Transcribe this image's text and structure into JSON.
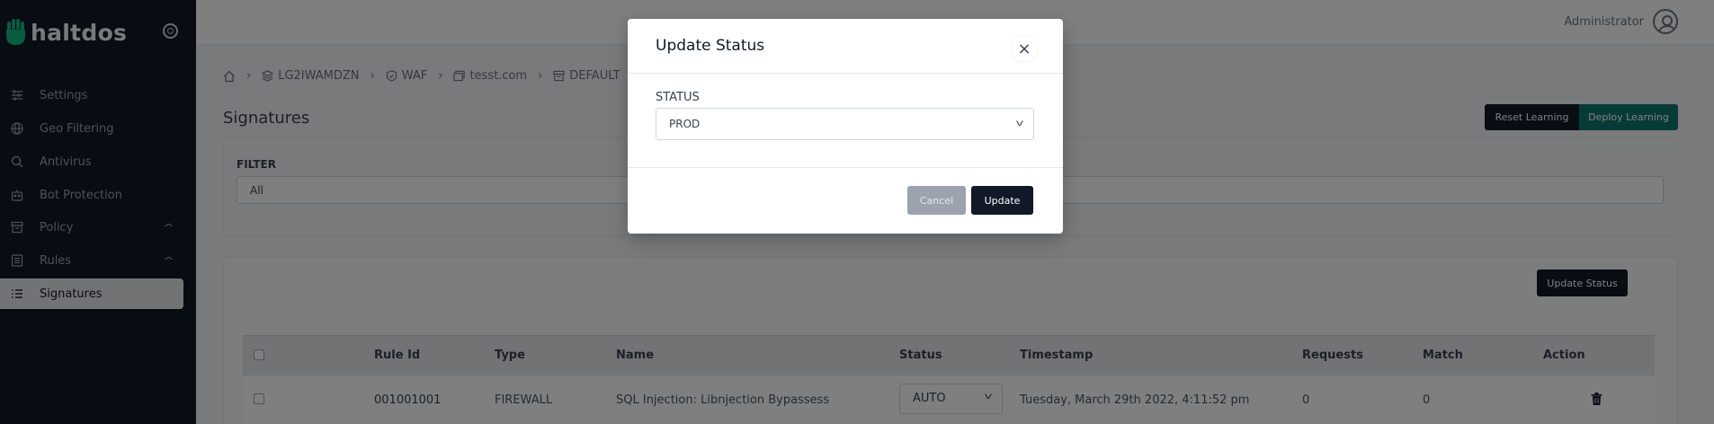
{
  "brand": {
    "name": "haltdos"
  },
  "sidebar": {
    "items": [
      {
        "label": "Settings",
        "icon": "sliders-icon"
      },
      {
        "label": "Geo Filtering",
        "icon": "globe-icon"
      },
      {
        "label": "Antivirus",
        "icon": "search-icon"
      },
      {
        "label": "Bot Protection",
        "icon": "robot-icon"
      },
      {
        "label": "Policy",
        "icon": "archive-icon"
      },
      {
        "label": "Rules",
        "icon": "document-icon"
      },
      {
        "label": "Signatures",
        "icon": "list-icon",
        "active": true
      }
    ]
  },
  "header": {
    "user": "Administrator"
  },
  "breadcrumb": [
    "LG2IWAMDZN",
    "WAF",
    "tesst.com",
    "DEFAULT"
  ],
  "page": {
    "title": "Signatures",
    "reset_label": "Reset Learning",
    "deploy_label": "Deploy Learning",
    "filter_label": "FILTER",
    "filter_value": "All",
    "update_status_label": "Update Status"
  },
  "table": {
    "headers": [
      "Rule Id",
      "Type",
      "Name",
      "Status",
      "Timestamp",
      "Requests",
      "Match",
      "Action"
    ],
    "rows": [
      {
        "rule_id": "001001001",
        "type": "FIREWALL",
        "name": "SQL Injection: Libnjection Bypassess",
        "status": "AUTO",
        "timestamp": "Tuesday, March 29th 2022, 4:11:52 pm",
        "requests": "0",
        "match": "0"
      }
    ]
  },
  "modal": {
    "title": "Update Status",
    "close": "×",
    "field_label": "STATUS",
    "field_value": "PROD",
    "cancel_label": "Cancel",
    "update_label": "Update"
  },
  "colors": {
    "sidebar": "#111827",
    "accent": "#0f766e",
    "primary_button": "#111827"
  }
}
